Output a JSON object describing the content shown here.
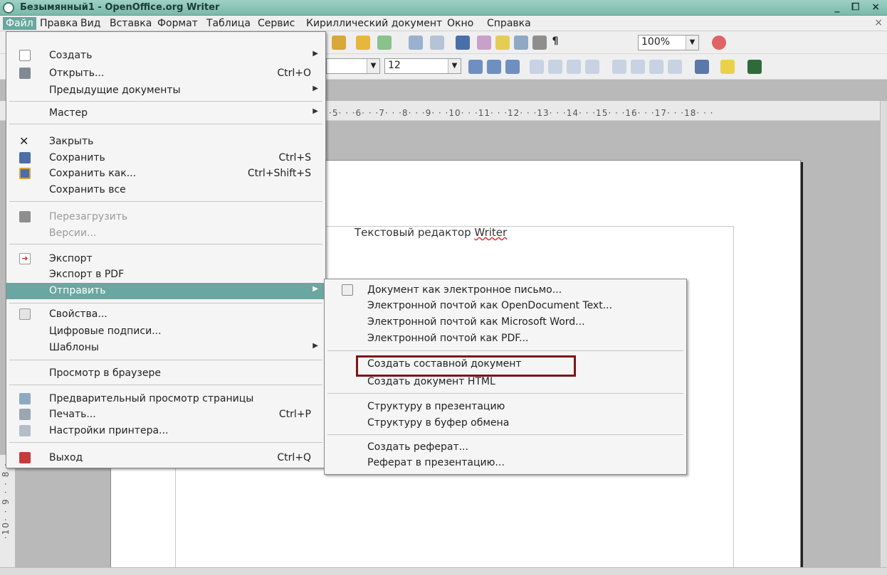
{
  "titlebar": {
    "title": "Безымянный1 - OpenOffice.org Writer",
    "buttons": "_ ⧠ ×"
  },
  "menubar": {
    "items": [
      "Файл",
      "Правка",
      "Вид",
      "Вставка",
      "Формат",
      "Таблица",
      "Сервис",
      "Кириллический документ",
      "Окно",
      "Справка"
    ],
    "close": "×"
  },
  "toolbar": {
    "zoom": "100%",
    "font_size": "12"
  },
  "ruler": {
    "ticks": "·5· · ·6· · ·7· · ·8· · ·9· · ·10· · ·11· · ·12· · ·13· · ·14· · ·15· · ·16· · ·17· · ·18· · ·"
  },
  "vertical_ruler": {
    "ticks": "·10· · 9 · · 8 ·"
  },
  "document": {
    "text_prefix": "Текстовый редактор ",
    "text_word": "Writer"
  },
  "file_menu": {
    "items": [
      {
        "label": "Создать",
        "shortcut": "",
        "submenu": true
      },
      {
        "label": "Открыть...",
        "shortcut": "Ctrl+O",
        "submenu": false
      },
      {
        "label": "Предыдущие документы",
        "shortcut": "",
        "submenu": true
      },
      {
        "label": "Мастер",
        "shortcut": "",
        "submenu": true
      },
      {
        "label": "Закрыть",
        "shortcut": "",
        "submenu": false
      },
      {
        "label": "Сохранить",
        "shortcut": "Ctrl+S",
        "submenu": false
      },
      {
        "label": "Сохранить как...",
        "shortcut": "Ctrl+Shift+S",
        "submenu": false
      },
      {
        "label": "Сохранить все",
        "shortcut": "",
        "submenu": false
      },
      {
        "label": "Перезагрузить",
        "shortcut": "",
        "submenu": false
      },
      {
        "label": "Версии...",
        "shortcut": "",
        "submenu": false
      },
      {
        "label": "Экспорт",
        "shortcut": "",
        "submenu": false
      },
      {
        "label": "Экспорт в PDF",
        "shortcut": "",
        "submenu": false
      },
      {
        "label": "Отправить",
        "shortcut": "",
        "submenu": true
      },
      {
        "label": "Свойства...",
        "shortcut": "",
        "submenu": false
      },
      {
        "label": "Цифровые подписи...",
        "shortcut": "",
        "submenu": false
      },
      {
        "label": "Шаблоны",
        "shortcut": "",
        "submenu": true
      },
      {
        "label": "Просмотр в браузере",
        "shortcut": "",
        "submenu": false
      },
      {
        "label": "Предварительный просмотр страницы",
        "shortcut": "",
        "submenu": false
      },
      {
        "label": "Печать...",
        "shortcut": "Ctrl+P",
        "submenu": false
      },
      {
        "label": "Настройки принтера...",
        "shortcut": "",
        "submenu": false
      },
      {
        "label": "Выход",
        "shortcut": "Ctrl+Q",
        "submenu": false
      }
    ]
  },
  "send_submenu": {
    "items": [
      "Документ как электронное письмо...",
      "Электронной почтой как OpenDocument Text...",
      "Электронной почтой как Microsoft Word...",
      "Электронной почтой как PDF...",
      "Создать составной документ",
      "Создать документ HTML",
      "Структуру в презентацию",
      "Структуру в буфер обмена",
      "Создать реферат...",
      "Реферат в презентацию..."
    ]
  },
  "colors": {
    "highlight": "#6aa7a0",
    "annotation_box": "#7a1717",
    "titlebar": "#8cc4b7"
  }
}
